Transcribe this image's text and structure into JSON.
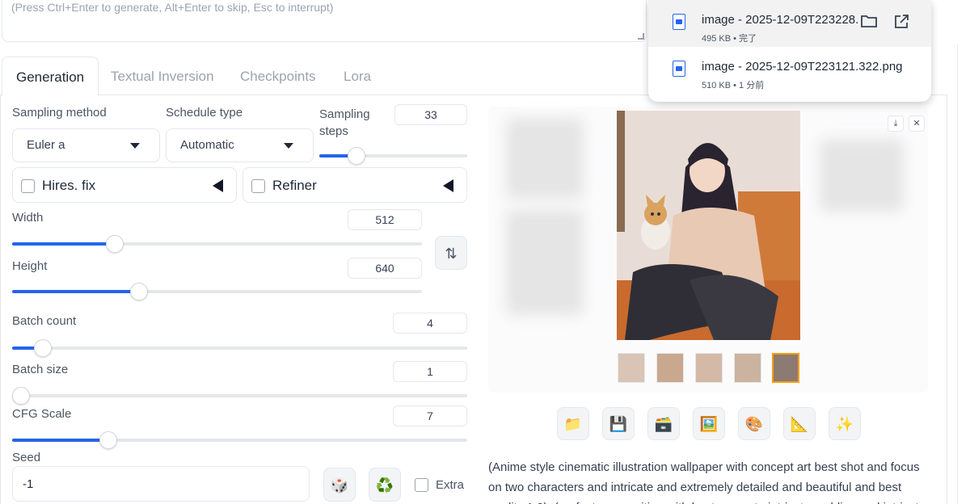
{
  "prompt": {
    "placeholder": "(Press Ctrl+Enter to generate, Alt+Enter to skip, Esc to interrupt)"
  },
  "tabs": [
    {
      "label": "Generation",
      "active": true
    },
    {
      "label": "Textual Inversion"
    },
    {
      "label": "Checkpoints"
    },
    {
      "label": "Lora"
    }
  ],
  "sampling_method": {
    "label": "Sampling method",
    "value": "Euler a"
  },
  "schedule_type": {
    "label": "Schedule type",
    "value": "Automatic"
  },
  "sampling_steps": {
    "label": "Sampling steps",
    "value": "33",
    "fraction": 0.22
  },
  "hires_fix": {
    "label": "Hires. fix",
    "checked": false
  },
  "refiner": {
    "label": "Refiner",
    "checked": false
  },
  "width": {
    "label": "Width",
    "value": "512",
    "fraction": 0.24
  },
  "height": {
    "label": "Height",
    "value": "640",
    "fraction": 0.3
  },
  "batch_count": {
    "label": "Batch count",
    "value": "4",
    "fraction": 0.05
  },
  "batch_size": {
    "label": "Batch size",
    "value": "1",
    "fraction": 0.0
  },
  "cfg_scale": {
    "label": "CFG Scale",
    "value": "7",
    "fraction": 0.2
  },
  "seed": {
    "label": "Seed",
    "value": "-1",
    "extra_label": "Extra"
  },
  "swap_icon": "swap-vertical-icon",
  "info_text": "(Anime style cinematic illustration wallpaper with concept art best shot and focus on two characters and intricate and extremely detailed and beautiful and best quality:1.2), (perfect composition with best accurate intricate molding and intricate",
  "downloads": [
    {
      "name": "image - 2025-12-09T223228.",
      "meta": "495 KB • 完了"
    },
    {
      "name": "image - 2025-12-09T223121.322.png",
      "meta": "510 KB • 1 分前"
    }
  ],
  "colors": {
    "accent": "#2563eb",
    "selected_thumb": "#f59e0b"
  }
}
